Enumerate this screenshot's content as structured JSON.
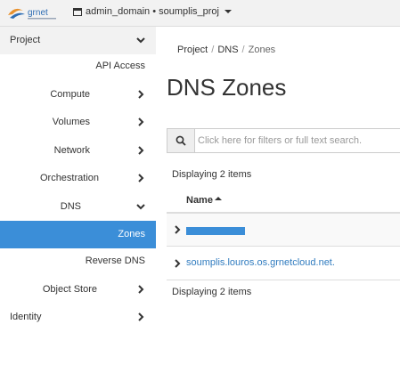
{
  "header": {
    "logo_text": "grnet",
    "project_selector": "admin_domain • soumplis_proj"
  },
  "sidebar": {
    "items": [
      {
        "label": "Project"
      },
      {
        "label": "API Access"
      },
      {
        "label": "Compute"
      },
      {
        "label": "Volumes"
      },
      {
        "label": "Network"
      },
      {
        "label": "Orchestration"
      },
      {
        "label": "DNS"
      },
      {
        "label": "Zones"
      },
      {
        "label": "Reverse DNS"
      },
      {
        "label": "Object Store"
      },
      {
        "label": "Identity"
      }
    ],
    "active_item": "Zones",
    "active_color": "#3b8ed8"
  },
  "breadcrumb": [
    "Project",
    "DNS",
    "Zones"
  ],
  "page_title": "DNS Zones",
  "search": {
    "placeholder": "Click here for filters or full text search."
  },
  "table": {
    "count_top": "Displaying 2 items",
    "count_bottom": "Displaying 2 items",
    "columns": [
      {
        "label": "Name",
        "sort": "ascending"
      }
    ],
    "rows": [
      {
        "name": "",
        "redacted": true
      },
      {
        "name": "soumplis.louros.os.grnetcloud.net."
      }
    ]
  }
}
